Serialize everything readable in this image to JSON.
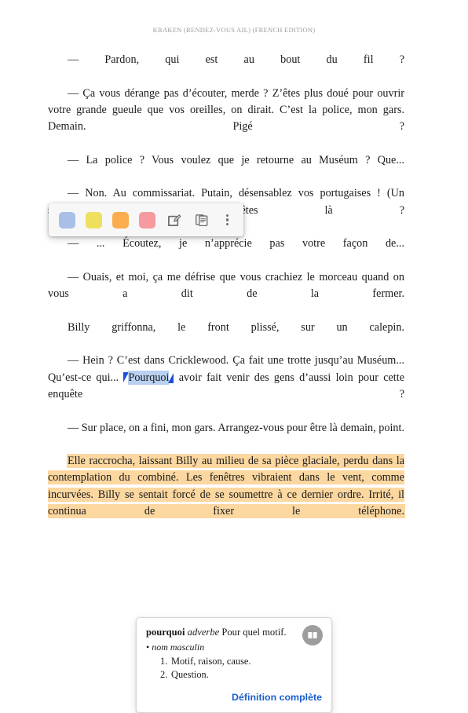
{
  "reader": {
    "running_header": "KRAKEN (RENDEZ-VOUS AIL) (FRENCH EDITION)",
    "paragraphs": [
      {
        "id": "p1",
        "text": "— Pardon, qui est au bout du fil ?"
      },
      {
        "id": "p2",
        "text": "— Ça vous dérange pas d’écouter, merde ? Z’êtes plus doué pour ouvrir votre grande gueule que vos oreilles, on dirait. C’est la police, mon gars. Demain. Pigé ?"
      },
      {
        "id": "p3",
        "text": "— La police ? Vous voulez que je retourne au Muséum ? Que..."
      },
      {
        "id": "p4",
        "text": "— Non. Au commissariat. Putain, désensablez vos portugaises ! (Un silence.) Vous êtes là ?"
      },
      {
        "id": "p5",
        "text": "— ... Écoutez, je n’apprécie pas votre façon de..."
      },
      {
        "id": "p6",
        "text": "— Ouais, et moi, ça me défrise que vous crachiez le morceau quand on vous a dit de la fermer."
      },
      {
        "id": "p7",
        "text": "Billy griffonna, le front plissé, sur un calepin."
      },
      {
        "id": "p8_before",
        "text": "— Hein ? C’est dans Cricklewood. Ça fait une trotte jusqu’au Muséum... Qu’est-ce qui... "
      },
      {
        "id": "p8_selected",
        "text": "Pourquoi"
      },
      {
        "id": "p8_after",
        "text": " avoir fait venir des gens d’aussi loin pour cette enquête ?"
      },
      {
        "id": "p9",
        "text": "— Sur place, on a fini, mon gars. Arrangez-vous pour être là demain, point."
      },
      {
        "id": "p10_highlight",
        "text": "Elle raccrocha, laissant Billy au milieu de sa pièce glaciale, perdu dans la contemplation du combiné. Les fenêtres vibraient dans le vent, comme incurvées. Billy se sentait forcé de se soumettre à ce dernier ordre. Irrité, il continua de fixer le téléphone."
      }
    ],
    "highlight_color": "#fcd7a0",
    "selection_color": "#b9d0f2",
    "selection_handle_color": "#1f4fd8"
  },
  "annotation_toolbar": {
    "swatches": [
      {
        "name": "blue",
        "color": "#a8c0e8"
      },
      {
        "name": "yellow",
        "color": "#eee05e"
      },
      {
        "name": "orange",
        "color": "#f9ad4e"
      },
      {
        "name": "pink",
        "color": "#f59a9e"
      }
    ],
    "icons": [
      {
        "name": "note-edit-icon"
      },
      {
        "name": "copy-icon"
      },
      {
        "name": "more-options-icon"
      }
    ]
  },
  "dictionary_popup": {
    "word": "pourquoi",
    "part_of_speech": "adverbe",
    "gloss": "Pour quel motif.",
    "category_bullet": "•",
    "category": "nom masculin",
    "senses": [
      {
        "number": "1.",
        "text": "Motif, raison, cause."
      },
      {
        "number": "2.",
        "text": "Question."
      }
    ],
    "full_definition_link": "Définition complète",
    "link_color": "#1a5fd0",
    "badge_icon": "open-book-icon"
  }
}
